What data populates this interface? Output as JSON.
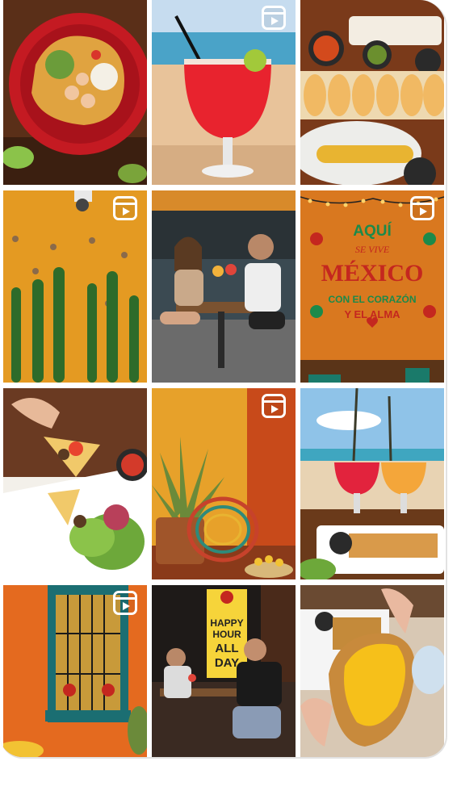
{
  "grid": {
    "tiles": [
      {
        "name": "tile-ceviche-bowl",
        "reel": false
      },
      {
        "name": "tile-beach-margarita",
        "reel": true
      },
      {
        "name": "tile-tacos-platter",
        "reel": false
      },
      {
        "name": "tile-cactus-wall",
        "reel": true
      },
      {
        "name": "tile-couple-cheers",
        "reel": false
      },
      {
        "name": "tile-mexico-mural",
        "reel": true,
        "mural": {
          "line1": "AQUÍ",
          "line2": "SE VIVE",
          "line3": "MÉXICO",
          "line4": "CON EL CORAZÓN",
          "line5": "Y EL ALMA"
        }
      },
      {
        "name": "tile-nachos-close",
        "reel": false
      },
      {
        "name": "tile-agave-patio",
        "reel": true
      },
      {
        "name": "tile-margaritas-beach-table",
        "reel": false
      },
      {
        "name": "tile-blue-window",
        "reel": true
      },
      {
        "name": "tile-happy-hour-couple",
        "reel": false,
        "sign": {
          "line1": "HAPPY",
          "line2": "HOUR",
          "line3": "ALL",
          "line4": "DAY"
        }
      },
      {
        "name": "tile-cheese-sandwich",
        "reel": false
      }
    ]
  },
  "colors": {
    "frame_border": "#e2e2e2",
    "reel_badge": "#ffffff",
    "mural_green": "#1c8a4a",
    "mural_red": "#c4271f",
    "sign_yellow": "#f6d43a"
  }
}
